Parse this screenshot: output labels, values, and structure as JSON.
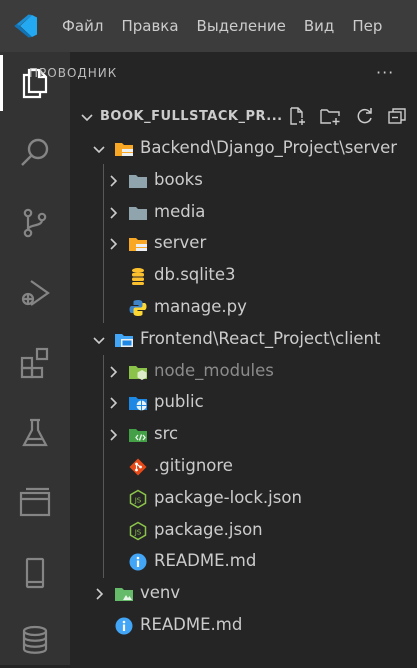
{
  "menu": [
    "Файл",
    "Правка",
    "Выделение",
    "Вид",
    "Пер"
  ],
  "activity_bar": [
    "explorer-icon",
    "search-icon",
    "source-control-icon",
    "run-debug-icon",
    "extensions-icon",
    "testing-icon",
    "remote-explorer-icon",
    "device-icon",
    "database-icon"
  ],
  "explorer": {
    "header": "ПРОВОДНИК",
    "more": "···",
    "section_title": "BOOK_FULLSTACK_PR...",
    "tree": [
      {
        "label": "Backend\\Django_Project\\server",
        "kind": "folder-server",
        "open": true,
        "depth": 0
      },
      {
        "label": "books",
        "kind": "folder",
        "open": false,
        "depth": 1
      },
      {
        "label": "media",
        "kind": "folder",
        "open": false,
        "depth": 1
      },
      {
        "label": "server",
        "kind": "folder-server",
        "open": false,
        "depth": 1
      },
      {
        "label": "db.sqlite3",
        "kind": "db",
        "depth": 1
      },
      {
        "label": "manage.py",
        "kind": "python",
        "depth": 1
      },
      {
        "label": "Frontend\\React_Project\\client",
        "kind": "folder-client",
        "open": true,
        "depth": 0
      },
      {
        "label": "node_modules",
        "kind": "folder-node",
        "open": false,
        "depth": 1
      },
      {
        "label": "public",
        "kind": "folder-public",
        "open": false,
        "depth": 1
      },
      {
        "label": "src",
        "kind": "folder-src",
        "open": false,
        "depth": 1
      },
      {
        "label": ".gitignore",
        "kind": "git",
        "depth": 1
      },
      {
        "label": "package-lock.json",
        "kind": "nodejs",
        "depth": 1
      },
      {
        "label": "package.json",
        "kind": "nodejs",
        "depth": 1
      },
      {
        "label": "README.md",
        "kind": "info",
        "depth": 1
      },
      {
        "label": "venv",
        "kind": "folder-venv",
        "open": false,
        "depth": 0
      },
      {
        "label": "README.md",
        "kind": "info",
        "depth": 0
      }
    ]
  },
  "colors": {
    "titlebar": "#3c3c3c",
    "activitybar": "#333333",
    "sidebar": "#252526",
    "vscode_blue": "#23a9f2",
    "folder_gray": "#90a4ae",
    "folder_yellow": "#f9a825",
    "node_green": "#8bc34a",
    "git_red": "#e64a19",
    "info_blue": "#42a5f5"
  }
}
